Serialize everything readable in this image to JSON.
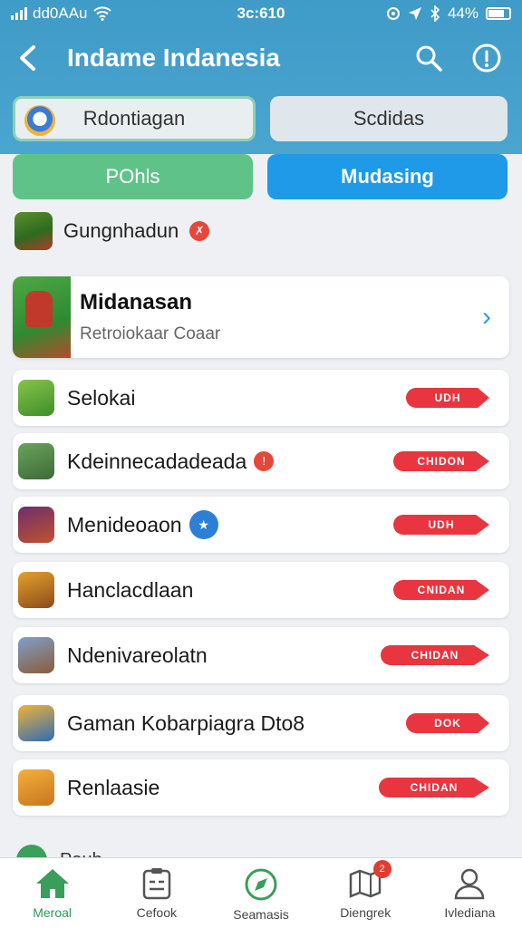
{
  "status_bar": {
    "carrier": "dd0AAu",
    "time": "3c:610",
    "battery": "44%"
  },
  "app_bar": {
    "title": "Indame Indanesia"
  },
  "segments_top": [
    {
      "label": "Rdontiagan",
      "active": true
    },
    {
      "label": "Scdidas",
      "active": false
    }
  ],
  "segments_bottom": [
    {
      "label": "POhls",
      "color": "#5fc389"
    },
    {
      "label": "Mudasing",
      "color": "#1e9ae8"
    }
  ],
  "section": {
    "title": "Gungnhadun",
    "badge": "✗"
  },
  "featured": {
    "title": "Midanasan",
    "subtitle": "Retroiokaar Coaar",
    "chevron": "›"
  },
  "list": [
    {
      "name": "Selokai",
      "button": "UDH",
      "badge": ""
    },
    {
      "name": "Kdeinnecadadeada",
      "button": "CHIDON",
      "badge": "red"
    },
    {
      "name": "Menideoaon",
      "button": "UDH",
      "badge": "blue"
    },
    {
      "name": "Hanclacdlaan",
      "button": "CNIDAN",
      "badge": ""
    },
    {
      "name": "Ndenivareolatn",
      "button": "CHIDAN",
      "badge": ""
    },
    {
      "name": "Gaman Kobarpiagra Dto8",
      "button": "DOK",
      "badge": ""
    },
    {
      "name": "Renlaasie",
      "button": "CHIDAN",
      "badge": ""
    }
  ],
  "partial_row": {
    "label": "Pauh"
  },
  "bottom_nav": [
    {
      "label": "Meroal",
      "icon": "home-icon",
      "active": true
    },
    {
      "label": "Cefook",
      "icon": "clipboard-icon",
      "active": false
    },
    {
      "label": "Seamasis",
      "icon": "compass-icon",
      "active": false
    },
    {
      "label": "Diengrek",
      "icon": "map-icon",
      "active": false,
      "badge": "2"
    },
    {
      "label": "Ivlediana",
      "icon": "user-icon",
      "active": false
    }
  ],
  "colors": {
    "header": "#4aa6cf",
    "accent_red": "#e8353f",
    "accent_green": "#2e9a52",
    "accent_blue": "#1e9ae8"
  }
}
